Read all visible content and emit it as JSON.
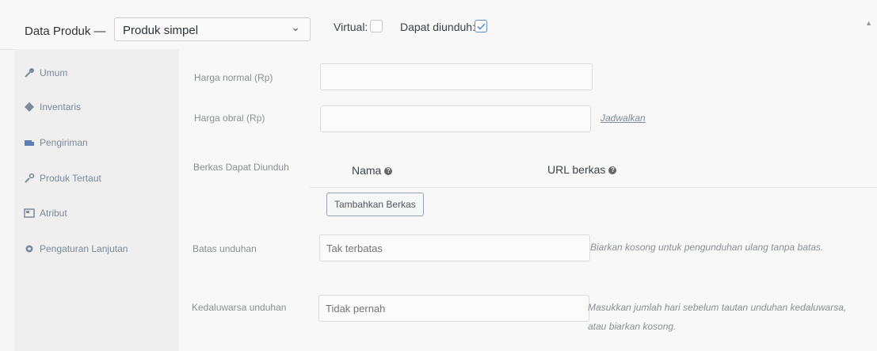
{
  "header": {
    "label": "Data Produk —",
    "product_type": "Produk simpel",
    "virtual_label": "Virtual:",
    "downloadable_label": "Dapat diunduh:"
  },
  "tabs": [
    {
      "label": "Umum",
      "icon": "wrench-icon"
    },
    {
      "label": "Inventaris",
      "icon": "diamond-icon"
    },
    {
      "label": "Pengiriman",
      "icon": "truck-icon"
    },
    {
      "label": "Produk Tertaut",
      "icon": "link-icon"
    },
    {
      "label": "Atribut",
      "icon": "table-icon"
    },
    {
      "label": "Pengaturan Lanjutan",
      "icon": "gear-icon"
    }
  ],
  "fields": {
    "regular_price_label": "Harga normal (Rp)",
    "sale_price_label": "Harga obral (Rp)",
    "schedule_link": "Jadwalkan",
    "downloadable_files_label": "Berkas Dapat Diunduh",
    "name_col": "Nama",
    "url_col": "URL berkas",
    "add_file_button": "Tambahkan Berkas",
    "download_limit_label": "Batas unduhan",
    "download_limit_placeholder": "Tak terbatas",
    "download_limit_help": "Biarkan kosong untuk pengunduhan ulang tanpa batas.",
    "download_expiry_label": "Kedaluwarsa unduhan",
    "download_expiry_placeholder": "Tidak pernah",
    "download_expiry_help": "Masukkan jumlah hari sebelum tautan unduhan kedaluwarsa, atau biarkan kosong."
  },
  "colors": {
    "check_accent": "#5e8fd6"
  }
}
